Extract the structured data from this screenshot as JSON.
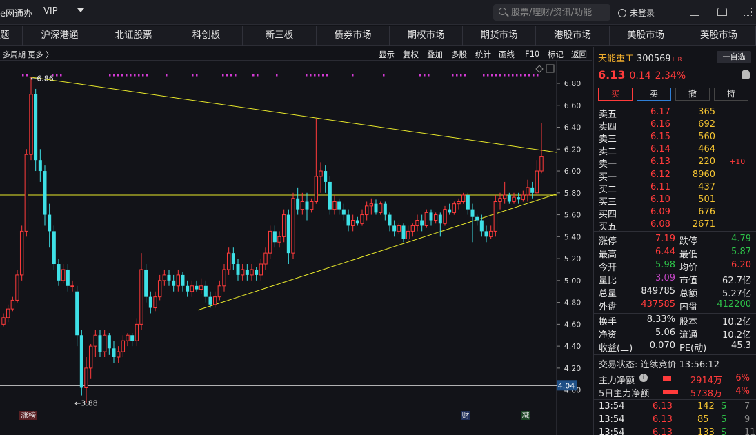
{
  "topbar": {
    "title": "e网通办",
    "vip": "VIP",
    "search_placeholder": "股票/理财/资讯/功能",
    "login": "未登录"
  },
  "nav": [
    "题",
    "沪深港通",
    "北证股票",
    "科创板",
    "新三板",
    "债券市场",
    "期权市场",
    "期货市场",
    "港股市场",
    "美股市场",
    "英股市场"
  ],
  "toolbar": {
    "period": "多周期  更多 〉",
    "buttons": [
      "显示",
      "复权",
      "叠加",
      "多股",
      "统计",
      "画线",
      "F10",
      "标记",
      "返回"
    ]
  },
  "chart_data": {
    "type": "candlestick",
    "y_ticks": [
      "6.80",
      "6.60",
      "6.40",
      "6.20",
      "6.00",
      "5.80",
      "5.60",
      "5.40",
      "5.20",
      "5.00",
      "4.80",
      "4.60",
      "4.40",
      "4.20",
      "4.00"
    ],
    "ylim": [
      3.86,
      6.92
    ],
    "high_label": "6.86",
    "low_label": "3.88",
    "current_price_tag": "4.04",
    "horizontal_line": 5.78,
    "marker_labels": [
      "涨榜",
      "财",
      "减"
    ],
    "candles": [
      [
        4.6,
        4.66,
        4.58,
        4.7
      ],
      [
        4.66,
        4.74,
        4.62,
        4.78
      ],
      [
        4.74,
        4.82,
        4.72,
        4.85
      ],
      [
        4.82,
        5.05,
        4.8,
        5.1
      ],
      [
        5.05,
        5.45,
        5.0,
        5.5
      ],
      [
        5.45,
        6.15,
        5.4,
        6.2
      ],
      [
        6.15,
        6.7,
        6.1,
        6.86
      ],
      [
        6.7,
        6.1,
        6.0,
        6.75
      ],
      [
        6.1,
        6.0,
        5.9,
        6.2
      ],
      [
        6.0,
        5.6,
        5.5,
        6.05
      ],
      [
        5.6,
        5.45,
        5.3,
        5.7
      ],
      [
        5.45,
        5.15,
        5.1,
        5.5
      ],
      [
        5.15,
        5.0,
        4.95,
        5.2
      ],
      [
        5.0,
        5.1,
        4.98,
        5.15
      ],
      [
        5.1,
        4.95,
        4.9,
        5.15
      ],
      [
        4.95,
        4.95,
        4.9,
        5.0
      ],
      [
        4.9,
        4.5,
        4.4,
        4.95
      ],
      [
        4.5,
        4.02,
        3.95,
        4.55
      ],
      [
        4.02,
        4.2,
        3.88,
        4.3
      ],
      [
        4.2,
        4.4,
        4.1,
        4.42
      ],
      [
        4.4,
        4.5,
        4.3,
        4.55
      ],
      [
        4.5,
        4.35,
        4.3,
        4.55
      ],
      [
        4.35,
        4.5,
        4.3,
        4.55
      ],
      [
        4.5,
        4.38,
        4.32,
        4.52
      ],
      [
        4.38,
        4.3,
        4.25,
        4.45
      ],
      [
        4.3,
        4.35,
        4.25,
        4.4
      ],
      [
        4.35,
        4.45,
        4.3,
        4.5
      ],
      [
        4.45,
        4.5,
        4.4,
        4.52
      ],
      [
        4.5,
        4.45,
        4.4,
        4.52
      ],
      [
        4.45,
        4.6,
        4.4,
        4.65
      ],
      [
        4.6,
        5.1,
        4.55,
        5.25
      ],
      [
        5.1,
        4.85,
        4.8,
        5.15
      ],
      [
        4.85,
        4.75,
        4.7,
        4.9
      ],
      [
        4.75,
        4.85,
        4.72,
        4.9
      ],
      [
        4.85,
        5.0,
        4.82,
        5.05
      ],
      [
        5.0,
        5.05,
        4.95,
        5.1
      ],
      [
        5.05,
        5.0,
        4.95,
        5.1
      ],
      [
        5.0,
        4.95,
        4.9,
        5.05
      ],
      [
        4.95,
        5.05,
        4.9,
        5.1
      ],
      [
        5.05,
        4.95,
        4.9,
        5.08
      ],
      [
        4.95,
        4.9,
        4.85,
        5.0
      ],
      [
        4.9,
        4.95,
        4.85,
        5.0
      ],
      [
        4.95,
        4.92,
        4.9,
        5.0
      ],
      [
        4.92,
        4.95,
        4.88,
        5.02
      ],
      [
        4.95,
        4.85,
        4.8,
        5.0
      ],
      [
        4.85,
        4.78,
        4.75,
        4.9
      ],
      [
        4.78,
        4.85,
        4.75,
        4.9
      ],
      [
        4.85,
        4.95,
        4.82,
        5.0
      ],
      [
        4.95,
        5.1,
        4.9,
        5.15
      ],
      [
        5.1,
        5.25,
        5.05,
        5.3
      ],
      [
        5.25,
        5.15,
        5.1,
        5.3
      ],
      [
        5.15,
        5.05,
        5.0,
        5.2
      ],
      [
        5.05,
        5.1,
        5.0,
        5.15
      ],
      [
        5.1,
        5.05,
        5.0,
        5.15
      ],
      [
        5.05,
        5.1,
        5.0,
        5.15
      ],
      [
        5.1,
        5.05,
        5.0,
        5.12
      ],
      [
        5.05,
        5.15,
        5.0,
        5.2
      ],
      [
        5.15,
        5.25,
        5.1,
        5.3
      ],
      [
        5.25,
        5.45,
        5.2,
        5.5
      ],
      [
        5.45,
        5.35,
        5.3,
        5.5
      ],
      [
        5.35,
        5.4,
        5.3,
        5.45
      ],
      [
        5.4,
        5.6,
        5.35,
        5.65
      ],
      [
        5.6,
        5.25,
        5.15,
        5.65
      ],
      [
        5.25,
        5.75,
        5.2,
        5.8
      ],
      [
        5.75,
        5.65,
        5.6,
        5.85
      ],
      [
        5.65,
        5.72,
        5.6,
        5.8
      ],
      [
        5.72,
        5.65,
        5.55,
        5.8
      ],
      [
        5.65,
        5.72,
        5.62,
        5.75
      ],
      [
        5.72,
        5.95,
        5.7,
        6.48
      ],
      [
        5.95,
        6.0,
        5.8,
        6.08
      ],
      [
        6.0,
        5.9,
        5.8,
        6.05
      ],
      [
        5.9,
        5.65,
        5.6,
        5.95
      ],
      [
        5.65,
        5.72,
        5.6,
        5.78
      ],
      [
        5.72,
        5.65,
        5.6,
        5.75
      ],
      [
        5.65,
        5.6,
        5.55,
        5.7
      ],
      [
        5.6,
        5.5,
        5.45,
        5.65
      ],
      [
        5.5,
        5.55,
        5.45,
        5.6
      ],
      [
        5.55,
        5.52,
        5.5,
        5.58
      ],
      [
        5.52,
        5.6,
        5.5,
        5.65
      ],
      [
        5.6,
        5.68,
        5.55,
        5.72
      ],
      [
        5.68,
        5.7,
        5.6,
        5.75
      ],
      [
        5.7,
        5.62,
        5.6,
        5.74
      ],
      [
        5.62,
        5.7,
        5.6,
        5.72
      ],
      [
        5.7,
        5.6,
        5.55,
        5.72
      ],
      [
        5.6,
        5.5,
        5.45,
        5.62
      ],
      [
        5.5,
        5.45,
        5.4,
        5.55
      ],
      [
        5.45,
        5.5,
        5.42,
        5.52
      ],
      [
        5.5,
        5.38,
        5.35,
        5.52
      ],
      [
        5.38,
        5.45,
        5.35,
        5.5
      ],
      [
        5.45,
        5.5,
        5.4,
        5.52
      ],
      [
        5.5,
        5.55,
        5.45,
        5.6
      ],
      [
        5.55,
        5.5,
        5.45,
        5.6
      ],
      [
        5.5,
        5.62,
        5.48,
        5.65
      ],
      [
        5.62,
        5.55,
        5.5,
        5.65
      ],
      [
        5.55,
        5.6,
        5.52,
        5.62
      ],
      [
        5.6,
        5.52,
        5.4,
        5.62
      ],
      [
        5.52,
        5.65,
        5.5,
        5.68
      ],
      [
        5.65,
        5.62,
        5.6,
        5.7
      ],
      [
        5.62,
        5.7,
        5.6,
        5.72
      ],
      [
        5.7,
        5.72,
        5.65,
        5.75
      ],
      [
        5.72,
        5.78,
        5.7,
        5.8
      ],
      [
        5.78,
        5.65,
        5.6,
        5.8
      ],
      [
        5.65,
        5.58,
        5.35,
        5.7
      ],
      [
        5.58,
        5.55,
        5.5,
        5.6
      ],
      [
        5.55,
        5.45,
        5.4,
        5.6
      ],
      [
        5.45,
        5.4,
        5.35,
        5.5
      ],
      [
        5.4,
        5.45,
        5.38,
        5.5
      ],
      [
        5.45,
        5.72,
        5.4,
        5.78
      ],
      [
        5.72,
        5.75,
        5.65,
        5.8
      ],
      [
        5.75,
        5.78,
        5.7,
        5.9
      ],
      [
        5.78,
        5.72,
        5.7,
        5.8
      ],
      [
        5.72,
        5.76,
        5.7,
        5.8
      ],
      [
        5.76,
        5.74,
        5.7,
        5.8
      ],
      [
        5.74,
        5.78,
        5.72,
        5.82
      ],
      [
        5.78,
        5.85,
        5.72,
        5.92
      ],
      [
        5.85,
        5.8,
        5.75,
        5.9
      ],
      [
        5.8,
        6.0,
        5.78,
        6.1
      ],
      [
        6.0,
        6.13,
        5.98,
        6.44
      ]
    ]
  },
  "stock": {
    "name": "天能重工",
    "code": "300569",
    "lr": "L R",
    "zixuan": "一自选",
    "price": "6.13",
    "change": "0.14",
    "pct": "2.34%"
  },
  "trade_buttons": [
    "买",
    "卖",
    "撤",
    "持"
  ],
  "sell_orders": [
    {
      "label": "卖五",
      "price": "6.17",
      "vol": "365"
    },
    {
      "label": "卖四",
      "price": "6.16",
      "vol": "692"
    },
    {
      "label": "卖三",
      "price": "6.15",
      "vol": "560"
    },
    {
      "label": "卖二",
      "price": "6.14",
      "vol": "464"
    },
    {
      "label": "卖一",
      "price": "6.13",
      "vol": "220",
      "extra": "+10"
    }
  ],
  "buy_orders": [
    {
      "label": "买一",
      "price": "6.12",
      "vol": "8960"
    },
    {
      "label": "买二",
      "price": "6.11",
      "vol": "437"
    },
    {
      "label": "买三",
      "price": "6.10",
      "vol": "501"
    },
    {
      "label": "买四",
      "price": "6.09",
      "vol": "676"
    },
    {
      "label": "买五",
      "price": "6.08",
      "vol": "2671"
    }
  ],
  "stats": [
    [
      {
        "l": "涨停",
        "v": "7.19",
        "c": "r"
      },
      {
        "l": "跌停",
        "v": "4.79",
        "c": "g"
      }
    ],
    [
      {
        "l": "最高",
        "v": "6.44",
        "c": "r"
      },
      {
        "l": "最低",
        "v": "5.87",
        "c": "g"
      }
    ],
    [
      {
        "l": "今开",
        "v": "5.98",
        "c": "g"
      },
      {
        "l": "均价",
        "v": "6.20",
        "c": "r"
      }
    ],
    [
      {
        "l": "量比",
        "v": "3.09",
        "c": "p"
      },
      {
        "l": "市值",
        "v": "62.7亿",
        "c": "w"
      }
    ],
    [
      {
        "l": "总量",
        "v": "849785",
        "c": "w"
      },
      {
        "l": "总额",
        "v": "5.27亿",
        "c": "w"
      }
    ],
    [
      {
        "l": "外盘",
        "v": "437585",
        "c": "r"
      },
      {
        "l": "内盘",
        "v": "412200",
        "c": "g"
      }
    ]
  ],
  "stats2": [
    [
      {
        "l": "换手",
        "v": "8.33%",
        "c": "w"
      },
      {
        "l": "股本",
        "v": "10.2亿",
        "c": "w"
      }
    ],
    [
      {
        "l": "净资",
        "v": "5.06",
        "c": "w"
      },
      {
        "l": "流通",
        "v": "10.2亿",
        "c": "w"
      }
    ],
    [
      {
        "l": "收益(二)",
        "v": "0.070",
        "c": "w"
      },
      {
        "l": "PE(动)",
        "v": "45.3",
        "c": "w"
      }
    ]
  ],
  "trade_status": "交易状态: 连续竞价 13:56:12",
  "capital": [
    {
      "label": "主力净额",
      "amount": "2914万",
      "pct": "6%"
    },
    {
      "label": "5日主力净额",
      "amount": "5738万",
      "pct": "4%"
    }
  ],
  "ticks": [
    {
      "time": "13:54",
      "price": "6.13",
      "vol": "142",
      "side": "S",
      "n": "7"
    },
    {
      "time": "13:54",
      "price": "6.13",
      "vol": "85",
      "side": "S",
      "n": "9"
    },
    {
      "time": "13:54",
      "price": "6.13",
      "vol": "133",
      "side": "S",
      "n": "11"
    }
  ]
}
